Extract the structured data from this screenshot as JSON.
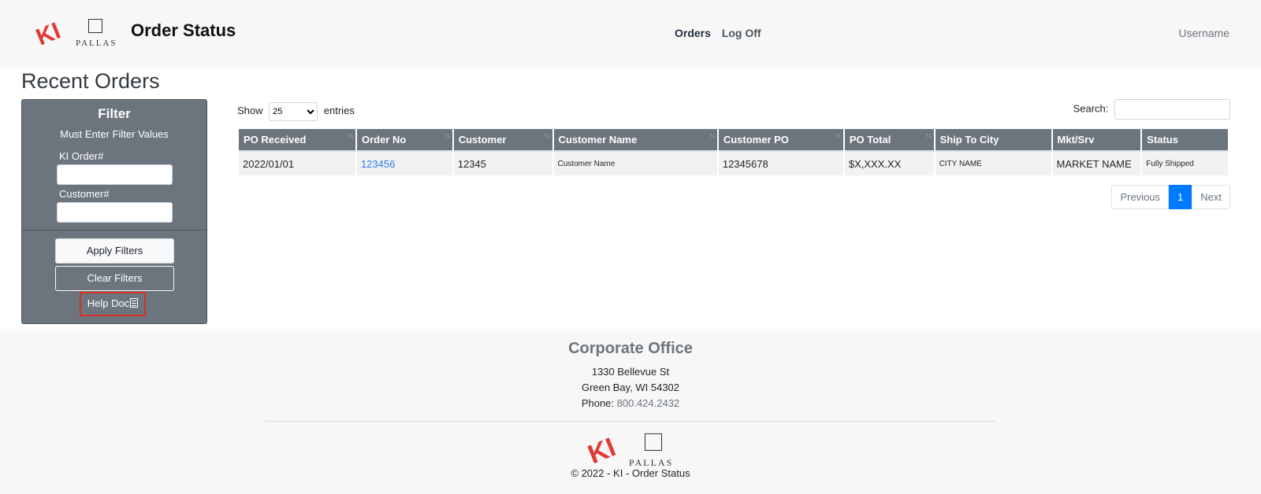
{
  "header": {
    "brand_logo": "KI",
    "partner_logo": "PALLAS",
    "title": "Order Status",
    "nav": [
      {
        "label": "Orders"
      },
      {
        "label": "Log Off"
      }
    ],
    "username": "Username"
  },
  "page_title": "Recent Orders",
  "filter": {
    "title": "Filter",
    "note": "Must Enter Filter Values",
    "order_label": "KI Order#",
    "customer_label": "Customer#",
    "apply_label": "Apply Filters",
    "clear_label": "Clear Filters",
    "help_label": "Help Doc"
  },
  "table_controls": {
    "show_label": "Show",
    "page_size": "25",
    "entries_label": "entries",
    "search_label": "Search:"
  },
  "table": {
    "columns": [
      "PO Received",
      "Order No",
      "Customer",
      "Customer Name",
      "Customer PO",
      "PO Total",
      "Ship To City",
      "Mkt/Srv",
      "Status"
    ],
    "rows": [
      [
        "2022/01/01",
        "123456",
        "12345",
        "Customer Name",
        "12345678",
        "$X,XXX.XX",
        "CITY NAME",
        "MARKET NAME",
        "Fully Shipped"
      ]
    ]
  },
  "pagination": {
    "previous": "Previous",
    "current": "1",
    "next": "Next"
  },
  "footer": {
    "office_title": "Corporate Office",
    "address_line1": "1330 Bellevue St",
    "address_line2": "Green Bay, WI 54302",
    "phone_label": "Phone:",
    "phone_number": "800.424.2432",
    "copyright": "© 2022 - KI - Order Status"
  },
  "colors": {
    "ki_red": "#e03a34",
    "panel_gray": "#6c757d",
    "link_blue": "#2c7be5",
    "active_page": "#007bff",
    "help_outline": "#d93025"
  },
  "icons": [
    "ki-logo",
    "pallas-logo",
    "document-icon",
    "sort-icon"
  ]
}
